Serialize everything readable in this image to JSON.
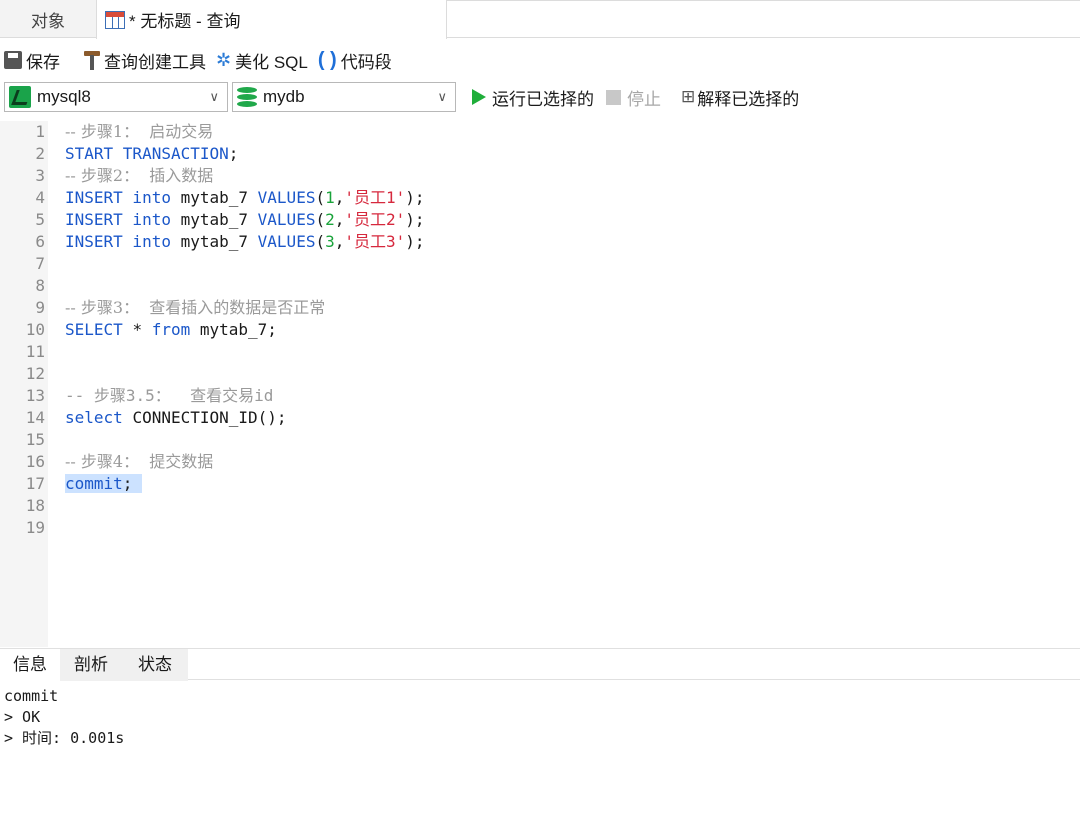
{
  "tabs": {
    "objects": "对象",
    "query": "* 无标题 - 查询"
  },
  "toolbar": {
    "save": "保存",
    "query_builder": "查询创建工具",
    "beautify": "美化 SQL",
    "snippet": "代码段"
  },
  "toolbar2": {
    "connection": "mysql8",
    "database": "mydb",
    "run_selected": "运行已选择的",
    "stop": "停止",
    "explain_selected": "解释已选择的"
  },
  "editor": {
    "line_numbers": [
      "1",
      "2",
      "3",
      "4",
      "5",
      "6",
      "7",
      "8",
      "9",
      "10",
      "11",
      "12",
      "13",
      "14",
      "15",
      "16",
      "17",
      "18",
      "19"
    ],
    "lines": [
      [
        {
          "t": "cm",
          "v": "-- 步骤1：  启动交易"
        }
      ],
      [
        {
          "t": "kw",
          "v": "START TRANSACTION"
        },
        {
          "t": "plain",
          "v": ";"
        }
      ],
      [
        {
          "t": "cm",
          "v": "-- 步骤2：  插入数据"
        }
      ],
      [
        {
          "t": "kw",
          "v": "INSERT into "
        },
        {
          "t": "plain",
          "v": "mytab_7 "
        },
        {
          "t": "kw",
          "v": "VALUES"
        },
        {
          "t": "plain",
          "v": "("
        },
        {
          "t": "num",
          "v": "1"
        },
        {
          "t": "plain",
          "v": ","
        },
        {
          "t": "str",
          "v": "'员工1'"
        },
        {
          "t": "plain",
          "v": ");"
        }
      ],
      [
        {
          "t": "kw",
          "v": "INSERT into "
        },
        {
          "t": "plain",
          "v": "mytab_7 "
        },
        {
          "t": "kw",
          "v": "VALUES"
        },
        {
          "t": "plain",
          "v": "("
        },
        {
          "t": "num",
          "v": "2"
        },
        {
          "t": "plain",
          "v": ","
        },
        {
          "t": "str",
          "v": "'员工2'"
        },
        {
          "t": "plain",
          "v": ");"
        }
      ],
      [
        {
          "t": "kw",
          "v": "INSERT into "
        },
        {
          "t": "plain",
          "v": "mytab_7 "
        },
        {
          "t": "kw",
          "v": "VALUES"
        },
        {
          "t": "plain",
          "v": "("
        },
        {
          "t": "num",
          "v": "3"
        },
        {
          "t": "plain",
          "v": ","
        },
        {
          "t": "str",
          "v": "'员工3'"
        },
        {
          "t": "plain",
          "v": ");"
        }
      ],
      [],
      [],
      [
        {
          "t": "cm",
          "v": "-- 步骤3：  查看插入的数据是否正常"
        }
      ],
      [
        {
          "t": "kw",
          "v": "SELECT "
        },
        {
          "t": "plain",
          "v": "* "
        },
        {
          "t": "kw",
          "v": "from "
        },
        {
          "t": "plain",
          "v": "mytab_7;"
        }
      ],
      [],
      [],
      [
        {
          "t": "cmm",
          "v": "-- 步骤3.5：  查看交易id"
        }
      ],
      [
        {
          "t": "kw",
          "v": "select "
        },
        {
          "t": "plain",
          "v": "CONNECTION_ID();"
        }
      ],
      [],
      [
        {
          "t": "cm",
          "v": "-- 步骤4：  提交数据"
        }
      ],
      [
        {
          "t": "kw sel",
          "v": "commit"
        },
        {
          "t": "plain sel",
          "v": "; "
        }
      ],
      [],
      []
    ]
  },
  "output_tabs": {
    "info": "信息",
    "profile": "剖析",
    "status": "状态"
  },
  "output": {
    "lines": [
      "commit",
      "> OK",
      "> 时间: 0.001s"
    ]
  },
  "colors": {
    "keyword": "#1b57c9",
    "comment": "#9a9a9a",
    "number": "#19a33a",
    "string": "#d6283d",
    "selection": "#cce2ff",
    "run": "#1fae3a"
  }
}
